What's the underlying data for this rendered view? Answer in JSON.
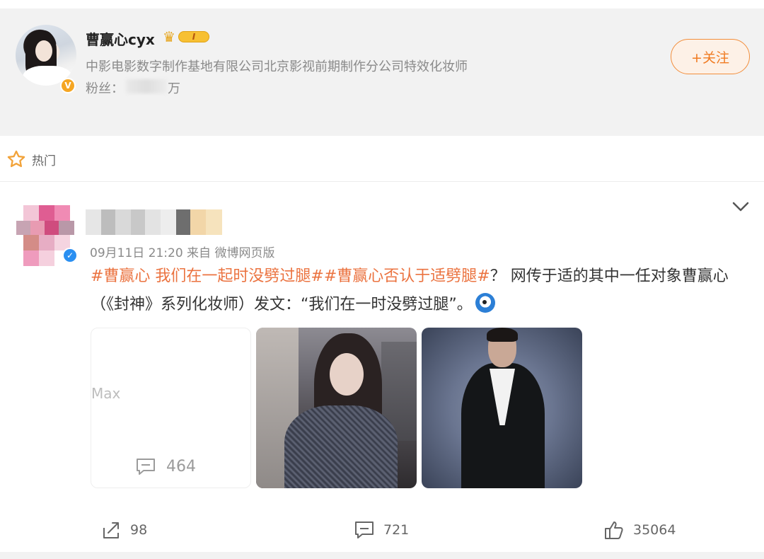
{
  "profile": {
    "name": "曹赢心cyx",
    "vip_level": "I",
    "description": "中影电影数字制作基地有限公司北京影视前期制作分公司特效化妆师",
    "fans_label": "粉丝：",
    "fans_unit": "万",
    "follow_label": "+关注",
    "verified_mark": "V"
  },
  "section": {
    "hot_label": "热门"
  },
  "post": {
    "meta": "09月11日 21:20  来自 微博网页版",
    "hashtag1": "#曹赢心 我们在一起时没劈过腿#",
    "hashtag2": "#曹赢心否认于适劈腿#",
    "text_main": "？ 网传于适的其中一任对象曹赢心（《封神》系列化妆师）发文：“我们在一时没劈过腿”。",
    "verified_mark": "✓",
    "images": {
      "first_watermark": "Max",
      "first_comment_count": "464"
    },
    "actions": {
      "share_count": "98",
      "comment_count": "721",
      "like_count": "35064"
    }
  },
  "colors": {
    "accent": "#eb7340",
    "follow_border": "#f28e3c",
    "header_bg": "#f2f2f2",
    "verified_blue": "#2a8ff1",
    "verified_gold": "#f5a623"
  },
  "icons": [
    "star-icon",
    "chevron-down-icon",
    "share-icon",
    "comment-icon",
    "like-icon",
    "crown-icon"
  ]
}
